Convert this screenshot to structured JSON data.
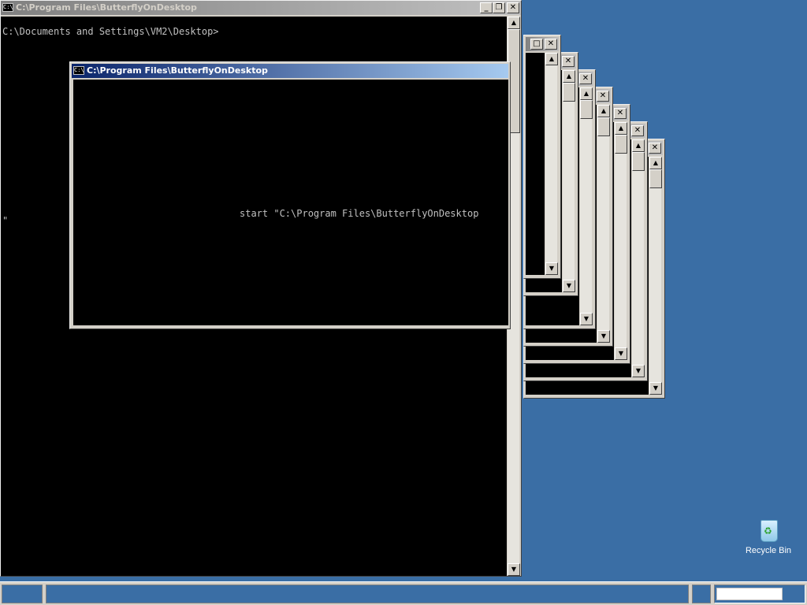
{
  "desktop": {
    "background": "#3a6ea5",
    "recycle_bin_label": "Recycle Bin"
  },
  "main_window": {
    "title": "C:\\Program Files\\ButterflyOnDesktop",
    "icon_text": "C:\\",
    "console_line1": "C:\\Documents and Settings\\VM2\\Desktop>",
    "console_quote": "\"",
    "buttons": {
      "minimize": "_",
      "restore": "❐",
      "close": "✕"
    }
  },
  "front_window": {
    "title": "C:\\Program Files\\ButterflyOnDesktop",
    "icon_text": "C:\\",
    "console_text": "start \"C:\\Program Files\\ButterflyOnDesktop"
  },
  "stacked_windows": {
    "count_visible": 8,
    "buttons": {
      "maximize": "□",
      "close": "✕"
    }
  },
  "scroll": {
    "up_arrow": "▲",
    "down_arrow": "▼"
  },
  "taskbar": {
    "background": "#d4d0c8"
  }
}
